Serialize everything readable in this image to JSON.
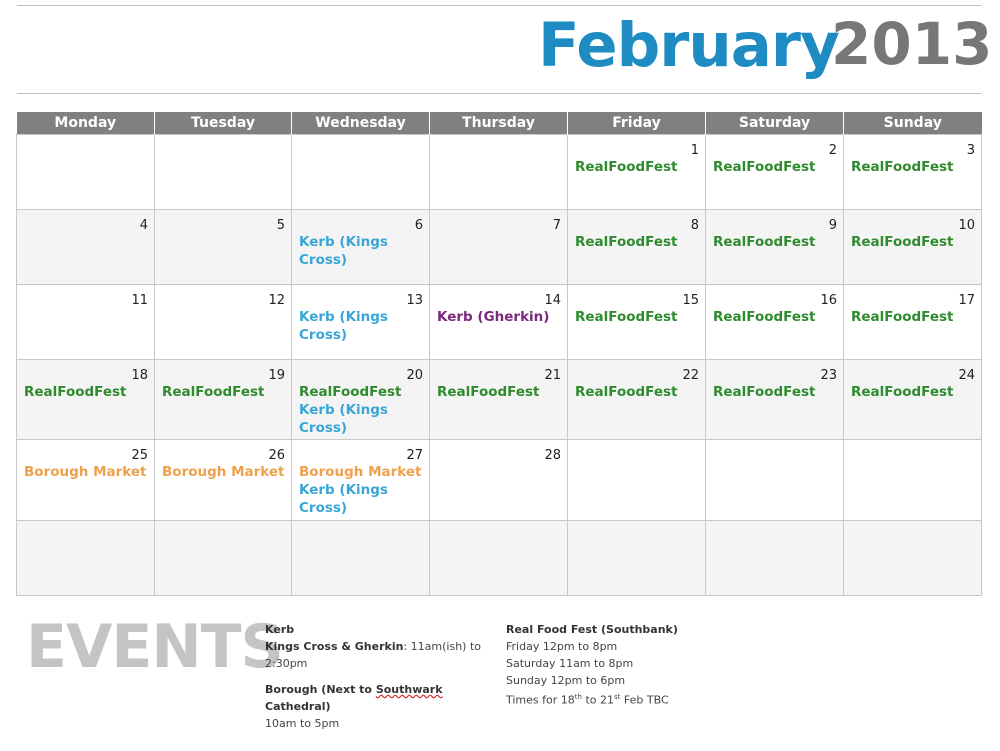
{
  "header": {
    "month": "February",
    "year": "2013"
  },
  "weekdays": [
    "Monday",
    "Tuesday",
    "Wednesday",
    "Thursday",
    "Friday",
    "Saturday",
    "Sunday"
  ],
  "weeks": [
    [
      {
        "day": "",
        "events": []
      },
      {
        "day": "",
        "events": []
      },
      {
        "day": "",
        "events": []
      },
      {
        "day": "",
        "events": []
      },
      {
        "day": "1",
        "events": [
          {
            "text": "RealFoodFest",
            "type": "rff"
          }
        ]
      },
      {
        "day": "2",
        "events": [
          {
            "text": "RealFoodFest",
            "type": "rff"
          }
        ]
      },
      {
        "day": "3",
        "events": [
          {
            "text": "RealFoodFest",
            "type": "rff"
          }
        ]
      }
    ],
    [
      {
        "day": "4",
        "events": []
      },
      {
        "day": "5",
        "events": []
      },
      {
        "day": "6",
        "events": [
          {
            "text": "Kerb (Kings Cross)",
            "type": "kerb"
          }
        ]
      },
      {
        "day": "7",
        "events": []
      },
      {
        "day": "8",
        "events": [
          {
            "text": "RealFoodFest",
            "type": "rff"
          }
        ]
      },
      {
        "day": "9",
        "events": [
          {
            "text": "RealFoodFest",
            "type": "rff"
          }
        ]
      },
      {
        "day": "10",
        "events": [
          {
            "text": "RealFoodFest",
            "type": "rff"
          }
        ]
      }
    ],
    [
      {
        "day": "11",
        "events": []
      },
      {
        "day": "12",
        "events": []
      },
      {
        "day": "13",
        "events": [
          {
            "text": "Kerb (Kings Cross)",
            "type": "kerb"
          }
        ]
      },
      {
        "day": "14",
        "events": [
          {
            "text": "Kerb (Gherkin)",
            "type": "gherkin"
          }
        ]
      },
      {
        "day": "15",
        "events": [
          {
            "text": "RealFoodFest",
            "type": "rff"
          }
        ]
      },
      {
        "day": "16",
        "events": [
          {
            "text": "RealFoodFest",
            "type": "rff"
          }
        ]
      },
      {
        "day": "17",
        "events": [
          {
            "text": "RealFoodFest",
            "type": "rff"
          }
        ]
      }
    ],
    [
      {
        "day": "18",
        "events": [
          {
            "text": "RealFoodFest",
            "type": "rff"
          }
        ]
      },
      {
        "day": "19",
        "events": [
          {
            "text": "RealFoodFest",
            "type": "rff"
          }
        ]
      },
      {
        "day": "20",
        "events": [
          {
            "text": "RealFoodFest",
            "type": "rff"
          },
          {
            "text": "Kerb (Kings Cross)",
            "type": "kerb"
          }
        ]
      },
      {
        "day": "21",
        "events": [
          {
            "text": "RealFoodFest",
            "type": "rff"
          }
        ]
      },
      {
        "day": "22",
        "events": [
          {
            "text": "RealFoodFest",
            "type": "rff"
          }
        ]
      },
      {
        "day": "23",
        "events": [
          {
            "text": "RealFoodFest",
            "type": "rff"
          }
        ]
      },
      {
        "day": "24",
        "events": [
          {
            "text": "RealFoodFest",
            "type": "rff"
          }
        ]
      }
    ],
    [
      {
        "day": "25",
        "events": [
          {
            "text": "Borough Market",
            "type": "borough"
          }
        ]
      },
      {
        "day": "26",
        "events": [
          {
            "text": "Borough Market",
            "type": "borough"
          }
        ]
      },
      {
        "day": "27",
        "events": [
          {
            "text": "Borough Market",
            "type": "borough"
          },
          {
            "text": "Kerb (Kings Cross)",
            "type": "kerb"
          }
        ]
      },
      {
        "day": "28",
        "events": []
      },
      {
        "day": "",
        "events": []
      },
      {
        "day": "",
        "events": []
      },
      {
        "day": "",
        "events": []
      }
    ],
    [
      {
        "day": "",
        "events": []
      },
      {
        "day": "",
        "events": []
      },
      {
        "day": "",
        "events": []
      },
      {
        "day": "",
        "events": []
      },
      {
        "day": "",
        "events": []
      },
      {
        "day": "",
        "events": []
      },
      {
        "day": "",
        "events": []
      }
    ]
  ],
  "colors": {
    "month_title": "#1e8bc3",
    "year_title": "#777777",
    "header_bar": "#808080",
    "rff": "#2e8b2e",
    "kerb": "#3aa6d8",
    "gherkin": "#7a2a7a",
    "borough": "#f0a04b"
  },
  "events_section": {
    "heading": "EVENTS",
    "kerb": {
      "title": "Kerb",
      "line1_label": "Kings Cross & Gherkin",
      "line1_value": ": 11am(ish) to 2:30pm",
      "line2_label_a": "Borough (Next to ",
      "line2_label_b": "Southwark",
      "line2_label_c": " Cathedral)",
      "line3": "10am to 5pm"
    },
    "rff": {
      "title": "Real Food Fest (Southbank)",
      "lines": [
        "Friday 12pm to 8pm",
        "Saturday 11am to 8pm",
        "Sunday 12pm to 6pm"
      ],
      "last_line_a": "Times for 18",
      "last_line_sup1": "th",
      "last_line_b": " to 21",
      "last_line_sup2": "st",
      "last_line_c": " Feb TBC"
    }
  }
}
